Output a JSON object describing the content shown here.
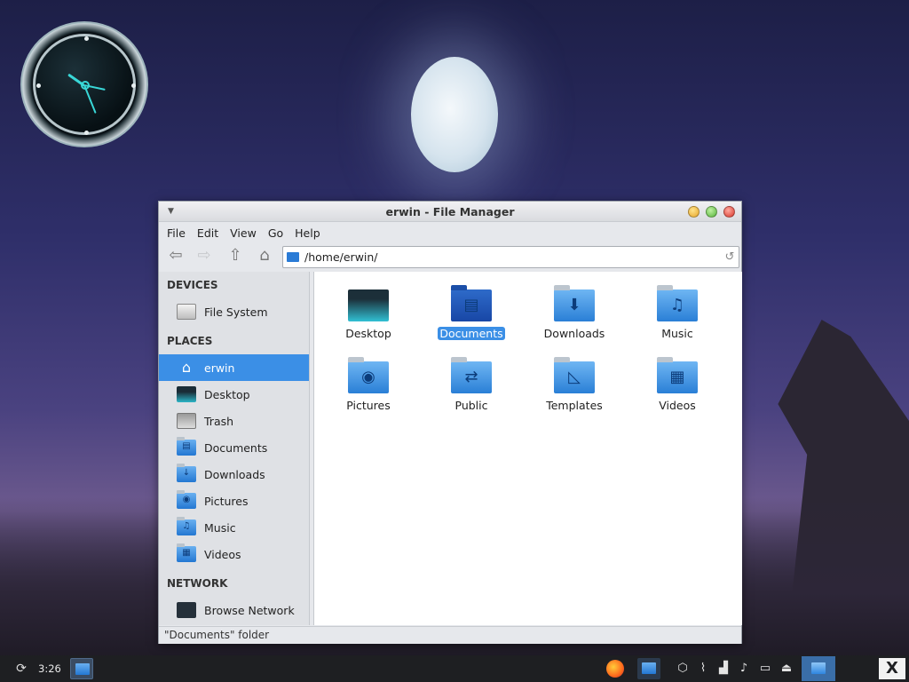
{
  "window": {
    "title": "erwin - File Manager",
    "menu": [
      "File",
      "Edit",
      "View",
      "Go",
      "Help"
    ],
    "path": "/home/erwin/",
    "status": "\"Documents\" folder"
  },
  "sidebar": {
    "devices_header": "DEVICES",
    "devices": [
      {
        "label": "File System",
        "icon": "drive-icon"
      }
    ],
    "places_header": "PLACES",
    "places": [
      {
        "label": "erwin",
        "icon": "home-icon",
        "active": true
      },
      {
        "label": "Desktop",
        "icon": "desktop-icon"
      },
      {
        "label": "Trash",
        "icon": "trash-icon"
      },
      {
        "label": "Documents",
        "icon": "documents-folder-icon"
      },
      {
        "label": "Downloads",
        "icon": "downloads-folder-icon"
      },
      {
        "label": "Pictures",
        "icon": "pictures-folder-icon"
      },
      {
        "label": "Music",
        "icon": "music-folder-icon"
      },
      {
        "label": "Videos",
        "icon": "videos-folder-icon"
      }
    ],
    "network_header": "NETWORK",
    "network": [
      {
        "label": "Browse Network",
        "icon": "network-icon"
      }
    ]
  },
  "files": [
    {
      "label": "Desktop",
      "icon": "desktop-folder-icon"
    },
    {
      "label": "Documents",
      "icon": "documents-folder-icon",
      "selected": true
    },
    {
      "label": "Downloads",
      "icon": "downloads-folder-icon"
    },
    {
      "label": "Music",
      "icon": "music-folder-icon"
    },
    {
      "label": "Pictures",
      "icon": "pictures-folder-icon"
    },
    {
      "label": "Public",
      "icon": "public-folder-icon"
    },
    {
      "label": "Templates",
      "icon": "templates-folder-icon"
    },
    {
      "label": "Videos",
      "icon": "videos-folder-icon"
    }
  ],
  "taskbar": {
    "time": "3:26"
  },
  "colors": {
    "selection": "#3b8fe6",
    "folder": "#2a7fd6",
    "taskbar": "#1e1f22"
  }
}
